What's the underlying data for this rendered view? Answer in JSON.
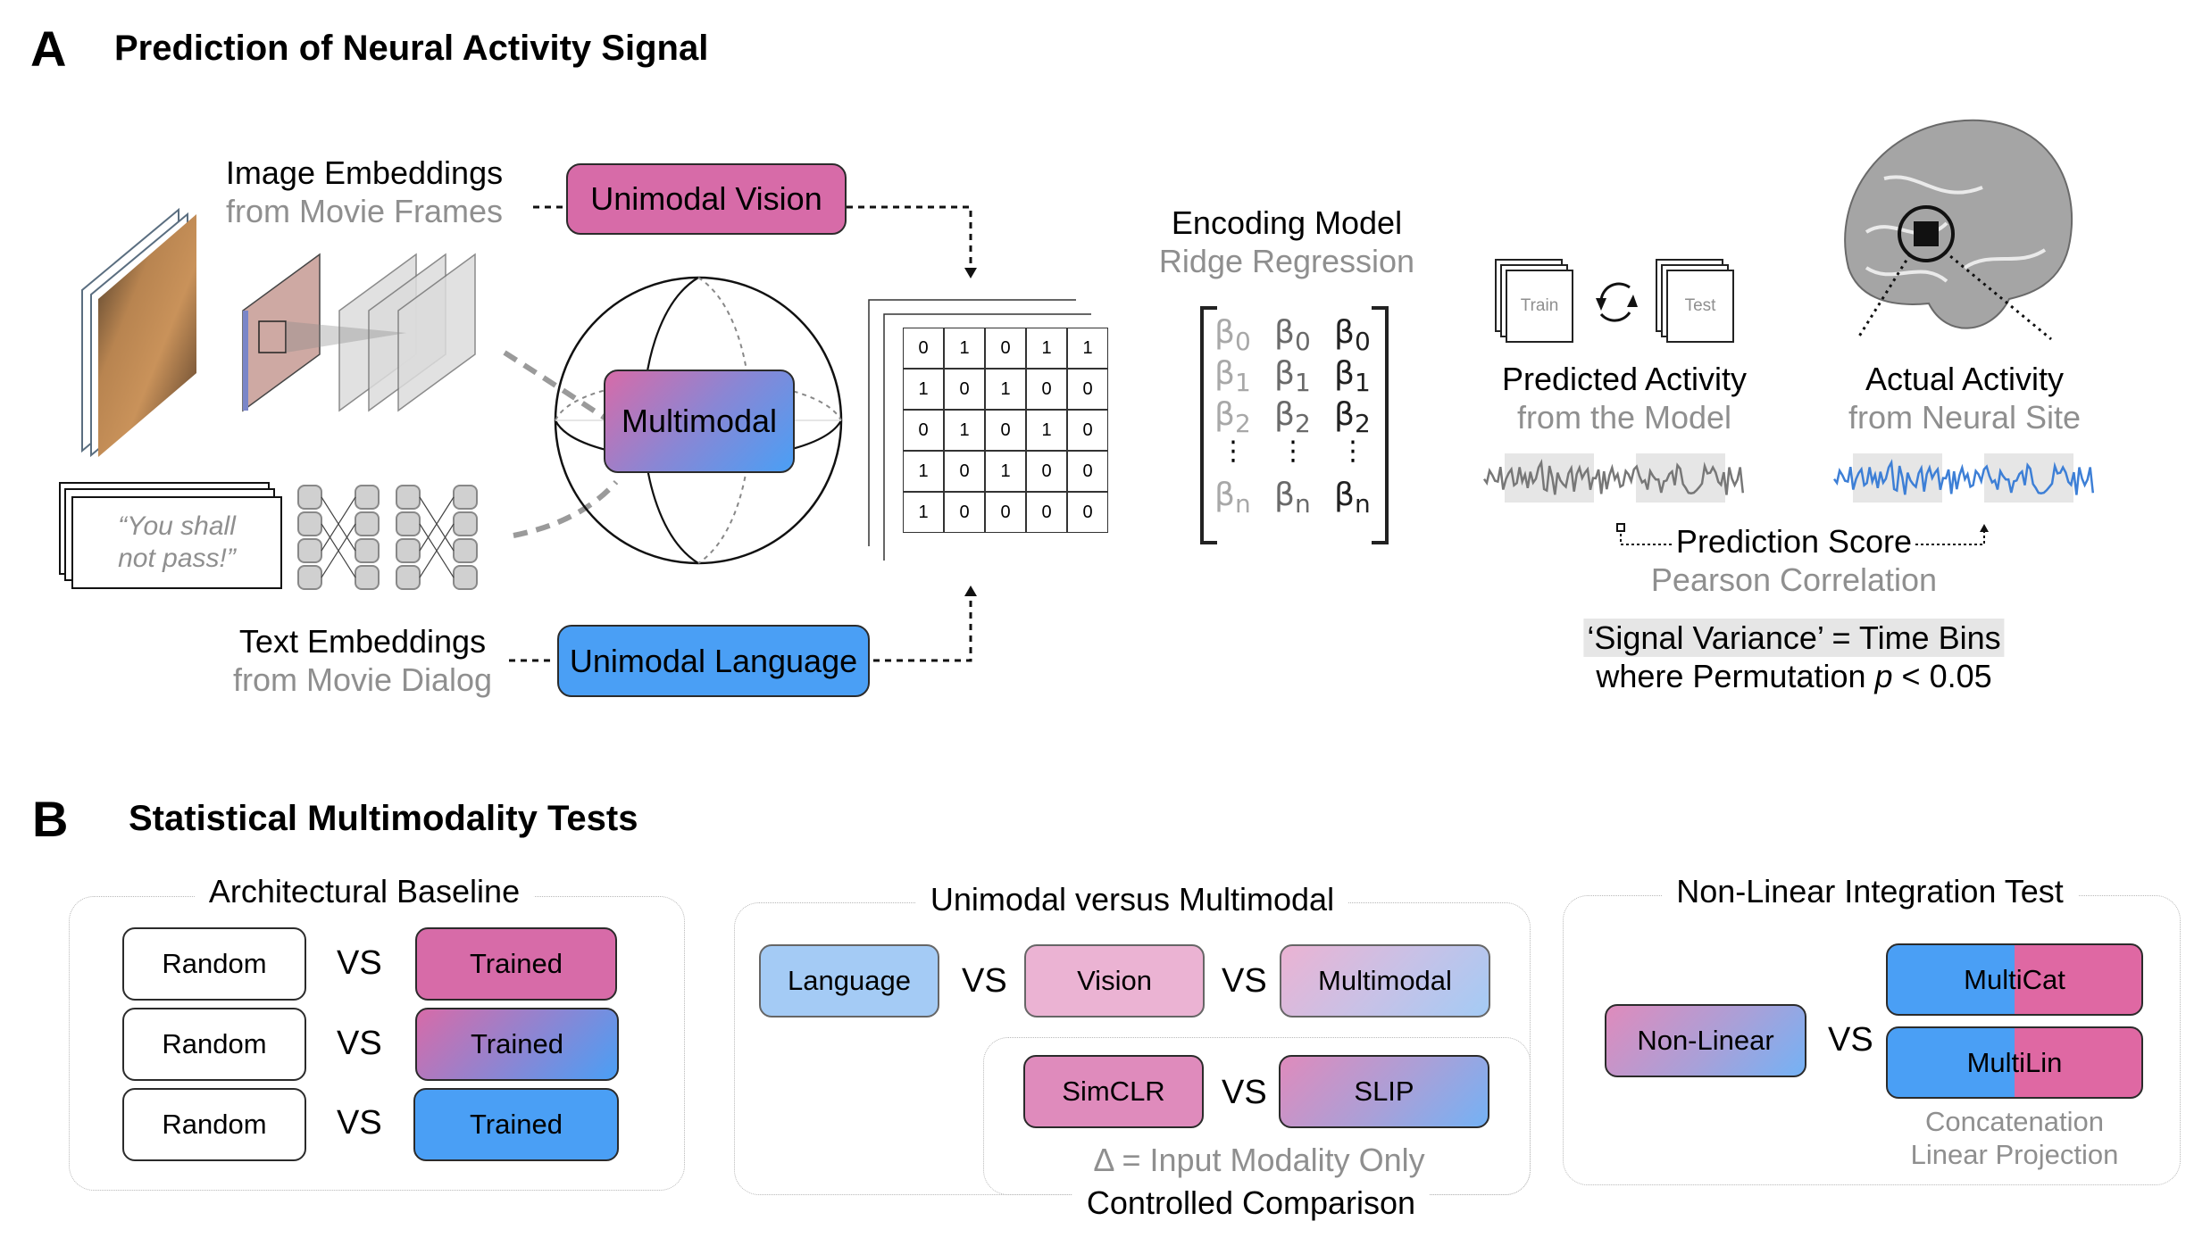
{
  "panel_a": {
    "letter": "A",
    "title": "Prediction of Neural Activity Signal",
    "image_embeddings": {
      "title": "Image Embeddings",
      "subtitle": "from Movie Frames"
    },
    "text_embeddings": {
      "title": "Text Embeddings",
      "subtitle": "from Movie Dialog"
    },
    "quote": {
      "line1": "“You shall",
      "line2": "not pass!”"
    },
    "unimodal_vision": "Unimodal Vision",
    "multimodal": "Multimodal",
    "unimodal_language": "Unimodal Language",
    "feature_matrix": [
      [
        0,
        1,
        0,
        1,
        1
      ],
      [
        1,
        0,
        1,
        0,
        0
      ],
      [
        0,
        1,
        0,
        1,
        0
      ],
      [
        1,
        0,
        1,
        0,
        0
      ],
      [
        1,
        0,
        0,
        0,
        0
      ]
    ],
    "encoding_model": {
      "title": "Encoding Model",
      "subtitle": "Ridge Regression"
    },
    "betas": {
      "symbol": "β",
      "rows": [
        "0",
        "1",
        "2",
        "n"
      ],
      "ellipsis": "⋮"
    },
    "train_label": "Train",
    "test_label": "Test",
    "predicted": {
      "title": "Predicted Activity",
      "subtitle": "from the Model"
    },
    "actual": {
      "title": "Actual Activity",
      "subtitle": "from Neural Site"
    },
    "prediction_score": {
      "title": "Prediction Score",
      "subtitle": "Pearson Correlation"
    },
    "signal_variance": {
      "line1": "‘Signal Variance’ = Time Bins",
      "line2_prefix": "where Permutation ",
      "line2_p": "p",
      "line2_suffix": " < 0.05"
    },
    "colors": {
      "vision": "#D76BA8",
      "language": "#4A9FF5",
      "predicted_wave": "#777777",
      "actual_wave": "#3D7FD6"
    }
  },
  "panel_b": {
    "letter": "B",
    "title": "Statistical Multimodality Tests",
    "architectural_baseline": {
      "title": "Architectural Baseline",
      "rows": [
        {
          "left": "Random",
          "vs": "VS",
          "right": "Trained"
        },
        {
          "left": "Random",
          "vs": "VS",
          "right": "Trained"
        },
        {
          "left": "Random",
          "vs": "VS",
          "right": "Trained"
        }
      ]
    },
    "unimodal_vs_multimodal": {
      "title": "Unimodal versus Multimodal",
      "items": [
        "Language",
        "Vision",
        "Multimodal"
      ],
      "vs": "VS",
      "controlled": {
        "items": [
          "SimCLR",
          "SLIP"
        ],
        "note": "Δ = Input Modality Only",
        "title": "Controlled Comparison"
      }
    },
    "nonlinear_integration": {
      "title": "Non-Linear Integration Test",
      "left": "Non-Linear",
      "vs": "VS",
      "right": [
        "MultiCat",
        "MultiLin"
      ],
      "caption1": "Concatenation",
      "caption2": "Linear Projection"
    }
  }
}
